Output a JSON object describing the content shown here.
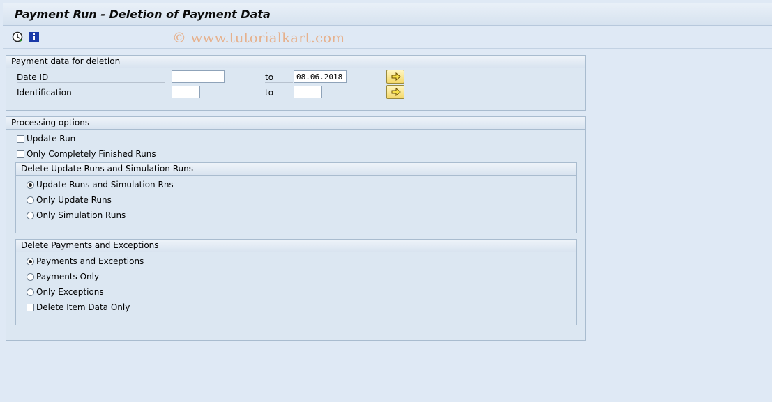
{
  "window": {
    "title": "Payment Run - Deletion of Payment Data"
  },
  "toolbar": {
    "execute_icon": "execute-clock-icon",
    "info_icon": "information-icon"
  },
  "watermark": "© www.tutorialkart.com",
  "payment_data": {
    "heading": "Payment data for deletion",
    "date_id_label": "Date ID",
    "date_id_from": "",
    "date_id_to_label": "to",
    "date_id_to": "08.06.2018",
    "identification_label": "Identification",
    "identification_from": "",
    "identification_to_label": "to",
    "identification_to": ""
  },
  "processing": {
    "heading": "Processing options",
    "update_run_label": "Update Run",
    "update_run_checked": false,
    "completely_finished_label": "Only Completely Finished Runs",
    "completely_finished_checked": false,
    "runs_group": {
      "heading": "Delete Update Runs and Simulation Runs",
      "options": [
        "Update Runs and Simulation Rns",
        "Only Update Runs",
        "Only Simulation Runs"
      ],
      "selected": "Update Runs and Simulation Rns"
    },
    "payments_group": {
      "heading": "Delete Payments and Exceptions",
      "options": [
        "Payments and Exceptions",
        "Payments Only",
        "Only Exceptions"
      ],
      "selected": "Payments and Exceptions",
      "item_data_label": "Delete Item Data Only",
      "item_data_checked": false
    }
  },
  "colors": {
    "background": "#dfe9f5",
    "group_border": "#a9bccf",
    "button_yellow": "#f4d86a"
  }
}
